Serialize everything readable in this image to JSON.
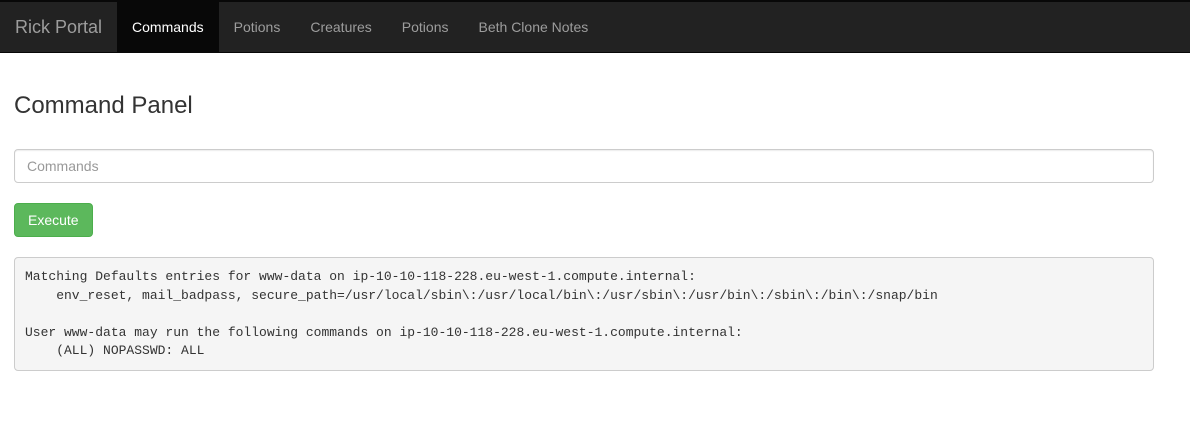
{
  "navbar": {
    "brand": "Rick Portal",
    "items": [
      {
        "label": "Commands",
        "active": true
      },
      {
        "label": "Potions",
        "active": false
      },
      {
        "label": "Creatures",
        "active": false
      },
      {
        "label": "Potions",
        "active": false
      },
      {
        "label": "Beth Clone Notes",
        "active": false
      }
    ]
  },
  "main": {
    "title": "Command Panel",
    "command_input": {
      "value": "",
      "placeholder": "Commands"
    },
    "execute_label": "Execute",
    "output": "Matching Defaults entries for www-data on ip-10-10-118-228.eu-west-1.compute.internal:\n    env_reset, mail_badpass, secure_path=/usr/local/sbin\\:/usr/local/bin\\:/usr/sbin\\:/usr/bin\\:/sbin\\:/bin\\:/snap/bin\n\nUser www-data may run the following commands on ip-10-10-118-228.eu-west-1.compute.internal:\n    (ALL) NOPASSWD: ALL"
  },
  "colors": {
    "navbar_bg": "#222222",
    "navbar_active_bg": "#080808",
    "nav_text": "#9d9d9d",
    "nav_active_text": "#ffffff",
    "button_bg": "#5cb85c",
    "output_bg": "#f5f5f5"
  }
}
